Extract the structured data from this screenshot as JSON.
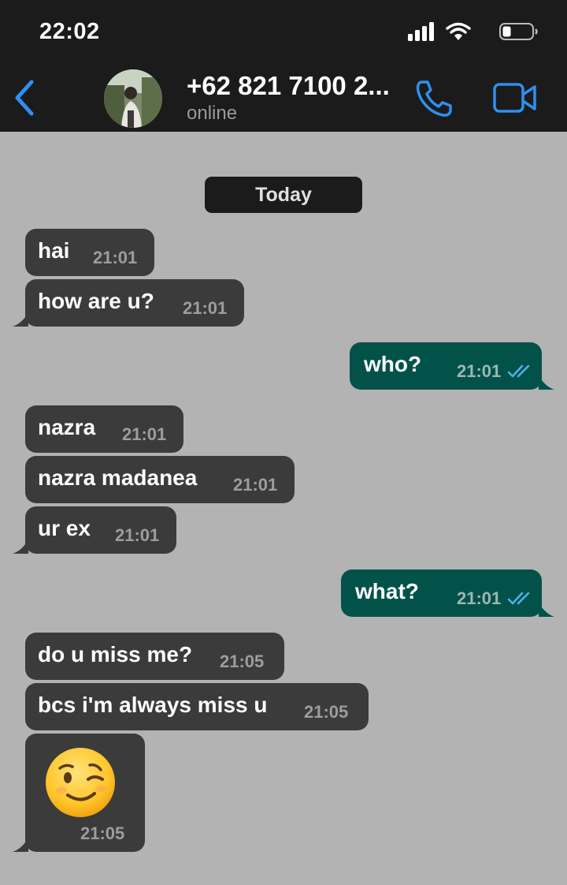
{
  "status_bar": {
    "time": "22:02"
  },
  "header": {
    "contact_name": "+62 821 7100 2...",
    "contact_status": "online"
  },
  "date_separator": "Today",
  "messages": [
    {
      "direction": "incoming",
      "text": "hai",
      "time": "21:01"
    },
    {
      "direction": "incoming",
      "text": "how are u?",
      "time": "21:01"
    },
    {
      "direction": "outgoing",
      "text": "who?",
      "time": "21:01",
      "read": true
    },
    {
      "direction": "incoming",
      "text": "nazra",
      "time": "21:01"
    },
    {
      "direction": "incoming",
      "text": "nazra madanea",
      "time": "21:01"
    },
    {
      "direction": "incoming",
      "text": "ur ex",
      "time": "21:01"
    },
    {
      "direction": "outgoing",
      "text": "what?",
      "time": "21:01",
      "read": true
    },
    {
      "direction": "incoming",
      "text": "do u miss me?",
      "time": "21:05"
    },
    {
      "direction": "incoming",
      "text": "bcs i'm always miss u",
      "time": "21:05"
    },
    {
      "direction": "incoming",
      "emoji": "winking-face",
      "time": "21:05"
    }
  ],
  "colors": {
    "background": "#b3b3b3",
    "header": "#1b1b1b",
    "accent": "#2f8ff0",
    "incoming_bubble": "#3b3b3b",
    "outgoing_bubble": "#03524a",
    "read_tick": "#4fb3e8"
  },
  "icons": [
    "signal-icon",
    "wifi-icon",
    "battery-icon",
    "back-icon",
    "call-icon",
    "video-call-icon",
    "read-receipt-icon",
    "winking-face-emoji"
  ]
}
